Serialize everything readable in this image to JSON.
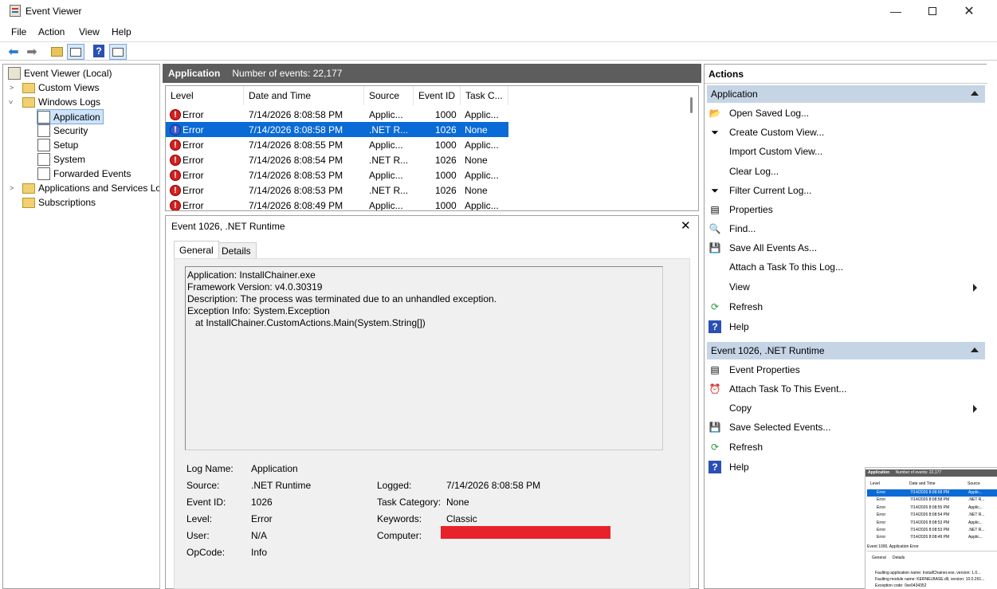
{
  "window": {
    "title": "Event Viewer"
  },
  "menu": [
    "File",
    "Action",
    "View",
    "Help"
  ],
  "tree": {
    "root": "Event Viewer (Local)",
    "custom_views": "Custom Views",
    "windows_logs": "Windows Logs",
    "application": "Application",
    "security": "Security",
    "setup": "Setup",
    "system": "System",
    "forwarded": "Forwarded Events",
    "apps_services": "Applications and Services Lo",
    "subscriptions": "Subscriptions"
  },
  "log_header": {
    "name": "Application",
    "count": "Number of events: 22,177"
  },
  "columns": [
    "Level",
    "Date and Time",
    "Source",
    "Event ID",
    "Task C..."
  ],
  "events": [
    {
      "level": "Error",
      "date": "7/14/2026 8:08:58 PM",
      "source": "Applic...",
      "id": "1000",
      "task": "Applic..."
    },
    {
      "level": "Error",
      "date": "7/14/2026 8:08:58 PM",
      "source": ".NET R...",
      "id": "1026",
      "task": "None"
    },
    {
      "level": "Error",
      "date": "7/14/2026 8:08:55 PM",
      "source": "Applic...",
      "id": "1000",
      "task": "Applic..."
    },
    {
      "level": "Error",
      "date": "7/14/2026 8:08:54 PM",
      "source": ".NET R...",
      "id": "1026",
      "task": "None"
    },
    {
      "level": "Error",
      "date": "7/14/2026 8:08:53 PM",
      "source": "Applic...",
      "id": "1000",
      "task": "Applic..."
    },
    {
      "level": "Error",
      "date": "7/14/2026 8:08:53 PM",
      "source": ".NET R...",
      "id": "1026",
      "task": "None"
    },
    {
      "level": "Error",
      "date": "7/14/2026 8:08:49 PM",
      "source": "Applic...",
      "id": "1000",
      "task": "Applic..."
    }
  ],
  "detail": {
    "title": "Event 1026, .NET Runtime",
    "tabs": [
      "General",
      "Details"
    ],
    "description": "Application: InstallChainer.exe\nFramework Version: v4.0.30319\nDescription: The process was terminated due to an unhandled exception.\nException Info: System.Exception\n   at InstallChainer.CustomActions.Main(System.String[])",
    "fields": {
      "log_name_label": "Log Name:",
      "log_name": "Application",
      "source_label": "Source:",
      "source": ".NET Runtime",
      "logged_label": "Logged:",
      "logged": "7/14/2026 8:08:58 PM",
      "event_id_label": "Event ID:",
      "event_id": "1026",
      "task_label": "Task Category:",
      "task": "None",
      "level_label": "Level:",
      "level": "Error",
      "keywords_label": "Keywords:",
      "keywords": "Classic",
      "user_label": "User:",
      "user": "N/A",
      "computer_label": "Computer:",
      "opcode_label": "OpCode:",
      "opcode": "Info"
    }
  },
  "actions": {
    "header": "Actions",
    "section1": "Application",
    "items1": [
      "Open Saved Log...",
      "Create Custom View...",
      "Import Custom View...",
      "Clear Log...",
      "Filter Current Log...",
      "Properties",
      "Find...",
      "Save All Events As...",
      "Attach a Task To this Log...",
      "View",
      "Refresh",
      "Help"
    ],
    "section2": "Event 1026, .NET Runtime",
    "items2": [
      "Event Properties",
      "Attach Task To This Event...",
      "Copy",
      "Save Selected Events...",
      "Refresh",
      "Help"
    ]
  },
  "thumbnail": {
    "header": "Application",
    "count": "Number of events: 22,177",
    "cols": [
      "Level",
      "Date and Time",
      "Source"
    ],
    "detail_title": "Event 1000, Application Error",
    "tabs": [
      "General",
      "Details"
    ],
    "text": [
      "Faulting application name: InstallChainer.exe, version: 1.0...",
      "Faulting module name: KERNELBASE.dll, version: 10.0.261...",
      "Exception code: 0xe0434352"
    ]
  },
  "colors": {
    "selection": "#0a6ad6",
    "section_bg": "#c5d5e6",
    "header_bg": "#5d5d5d",
    "redaction": "#e8222b"
  }
}
